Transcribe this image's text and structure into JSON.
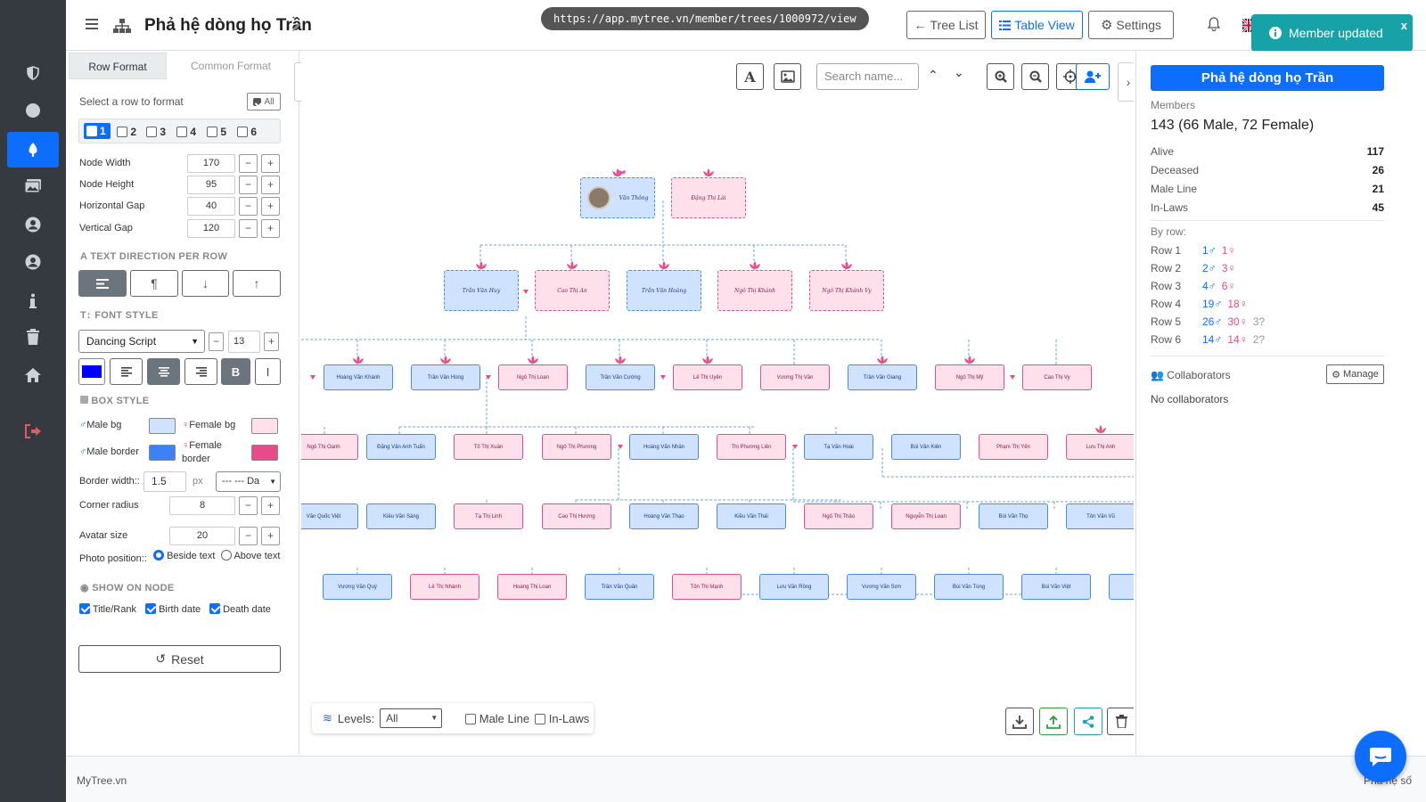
{
  "rail": {
    "items": [
      "shield-icon",
      "circle-icon",
      "tree-icon",
      "images-icon",
      "user-circle-icon",
      "user-circle-icon",
      "info-icon",
      "trash-icon",
      "home-icon",
      "logout-icon"
    ]
  },
  "header": {
    "title": "Phả hệ dòng họ Trần",
    "url": "https://app.mytree.vn/member/trees/1000972/view",
    "tree_list": "Tree List",
    "table_view": "Table View",
    "settings": "Settings"
  },
  "toast": {
    "text": "Member updated",
    "close": "x"
  },
  "left": {
    "tabs": [
      "Row Format",
      "Common Format"
    ],
    "select_row_label": "Select a row to format",
    "all_label": "All",
    "rows": [
      "1",
      "2",
      "3",
      "4",
      "5",
      "6"
    ],
    "node_width_label": "Node Width",
    "node_width": "170",
    "node_height_label": "Node Height",
    "node_height": "95",
    "hgap_label": "Horizontal Gap",
    "hgap": "40",
    "vgap_label": "Vertical Gap",
    "vgap": "120",
    "text_dir_head": "TEXT DIRECTION PER ROW",
    "font_head": "FONT STYLE",
    "font_family": "Dancing Script",
    "font_size": "13",
    "bold_label": "B",
    "italic_label": "I",
    "box_head": "BOX STYLE",
    "male_bg": "Male bg",
    "female_bg": "Female bg",
    "male_border": "Male border",
    "female_border": "Female border",
    "border_width_label": "Border width::",
    "border_width": "1.5",
    "px": "px",
    "border_style": "--- --- Da",
    "corner_label": "Corner radius",
    "corner": "8",
    "avatar_label": "Avatar size",
    "avatar": "20",
    "photo_pos_label": "Photo position::",
    "beside": "Beside text",
    "above": "Above text",
    "show_head": "SHOW ON NODE",
    "title_rank": "Title/Rank",
    "birth": "Birth date",
    "death": "Death date",
    "reset": "Reset",
    "colors": {
      "male_bg": "#cfe2ff",
      "female_bg": "#fde0ea",
      "male_border": "#3b82f6",
      "female_border": "#e84b8a",
      "font": "#0000ff"
    }
  },
  "canvas": {
    "search_placeholder": "Search name...",
    "levels_label": "Levels:",
    "levels_value": "All",
    "male_line": "Male Line",
    "in_laws": "In-Laws",
    "tree": {
      "gen0": [
        "Văn Thông",
        "Đặng Thị Lài"
      ],
      "gen1": [
        "Trần Văn Huy",
        "Cao Thị An",
        "Trần Văn Hoàng",
        "Ngô Thị Khánh",
        "Ngô Thị Khánh Vy"
      ],
      "gen2": [
        "Hoàng Văn Khánh",
        "Trần Văn Hùng",
        "Ngô Thị Loan",
        "Trần Văn Cường",
        "Lê Thị Uyên",
        "Vương Thị Vân",
        "Trần Văn Giang",
        "Ngô Thị Mỹ",
        "Cao Thị Vy"
      ],
      "gen3": [
        "Ngô Thị Oanh",
        "Đặng Văn Anh Tuấn",
        "Tô Thị Xuân",
        "Ngô Thị Phương",
        "Hoàng Văn Nhân",
        "Thị Phương Liên",
        "Tạ Văn Hoài",
        "Bùi Văn Kiên",
        "Phạm Thị Yến",
        "Lưu Thị Anh"
      ],
      "gen4": [
        "Văn Quốc Việt",
        "Kiều Văn Sáng",
        "Tạ Thị Linh",
        "Cao Thị Hương",
        "Hoàng Văn Thạo",
        "Kiều Văn Thái",
        "Ngô Thị Thảo",
        "Nguyễn Thị Loan",
        "Bùi Văn Thọ",
        "Tôn Văn Vũ"
      ],
      "gen5": [
        "Vương Văn Quý",
        "Lê Thị Nhành",
        "Hoàng Thị Loan",
        "Trần Văn Quân",
        "Tôn Thị Mạnh",
        "Lưu Văn Rồng",
        "Vương Văn Sơn",
        "Bùi Văn Tùng",
        "Bùi Văn Việt",
        "Vũ"
      ]
    }
  },
  "right": {
    "title": "Phả hệ dòng họ Trần",
    "members_label": "Members",
    "members_value": "143 (66 Male, 72 Female)",
    "stats": [
      {
        "label": "Alive",
        "value": "117"
      },
      {
        "label": "Deceased",
        "value": "26"
      },
      {
        "label": "Male Line",
        "value": "21"
      },
      {
        "label": "In-Laws",
        "value": "45"
      }
    ],
    "by_row_label": "By row:",
    "rows": [
      {
        "label": "Row 1",
        "male": "1♂",
        "female": "1♀",
        "other": ""
      },
      {
        "label": "Row 2",
        "male": "2♂",
        "female": "3♀",
        "other": ""
      },
      {
        "label": "Row 3",
        "male": "4♂",
        "female": "6♀",
        "other": ""
      },
      {
        "label": "Row 4",
        "male": "19♂",
        "female": "18♀",
        "other": ""
      },
      {
        "label": "Row 5",
        "male": "26♂",
        "female": "30♀",
        "other": "3?"
      },
      {
        "label": "Row 6",
        "male": "14♂",
        "female": "14♀",
        "other": "2?"
      }
    ],
    "collab_label": "Collaborators",
    "manage": "Manage",
    "no_collab": "No collaborators"
  },
  "footer": {
    "brand": "MyTree.vn",
    "right": "Phả hệ số"
  }
}
